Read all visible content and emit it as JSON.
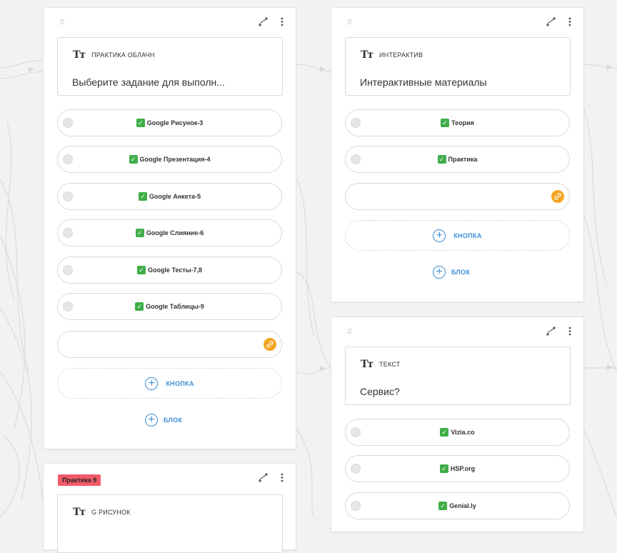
{
  "card1": {
    "hash": "#",
    "text_block": {
      "label": "ПРАКТИКА ОБЛАЧН",
      "body": "Выберите задание для выполн..."
    },
    "options": [
      "Google Рисунок-3",
      "Google Презентация-4",
      "Google Анкета-5",
      "Google Слияние-6",
      "Google Тесты-7,8",
      "Google Таблицы-9"
    ],
    "button_label": "КНОПКА",
    "block_label": "БЛОК"
  },
  "card2": {
    "hash": "#",
    "text_block": {
      "label": "ИНТЕРАКТИВ",
      "body": "Интерактивные материалы"
    },
    "options": [
      "Теория",
      "Практика"
    ],
    "button_label": "КНОПКА",
    "block_label": "БЛОК"
  },
  "card3": {
    "hash": "#",
    "text_block": {
      "label": "ТЕКСТ",
      "body": "Сервис?"
    },
    "options": [
      "Vizia.co",
      "HSP.org",
      "Genial.ly"
    ]
  },
  "card4": {
    "tag": "Практика 9",
    "text_block": {
      "label": "G РИСУНОК"
    }
  },
  "icons": {
    "text_type": "Tт",
    "check": "✓",
    "plus": "+"
  },
  "colors": {
    "accent_blue": "#3d8fd6",
    "check_green": "#3fae49",
    "link_orange": "#f4a521",
    "tag_red": "#f25a6a"
  }
}
